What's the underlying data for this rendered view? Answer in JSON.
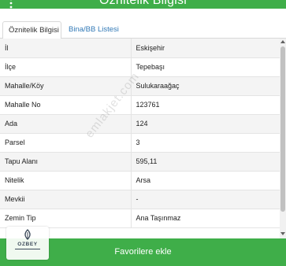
{
  "header": {
    "title": "Öznitelik Bilgisi",
    "menu_icon": "kebab-menu-icon"
  },
  "tabs": [
    {
      "label": "Öznitelik Bilgisi",
      "active": true
    },
    {
      "label": "Bina/BB Listesi",
      "active": false
    }
  ],
  "attributes": [
    {
      "key": "İl",
      "value": "Eskişehir"
    },
    {
      "key": "İlçe",
      "value": "Tepebaşı"
    },
    {
      "key": "Mahalle/Köy",
      "value": "Sulukaraağaç"
    },
    {
      "key": "Mahalle No",
      "value": "123761"
    },
    {
      "key": "Ada",
      "value": "124"
    },
    {
      "key": "Parsel",
      "value": "3"
    },
    {
      "key": "Tapu Alanı",
      "value": "595,11"
    },
    {
      "key": "Nitelik",
      "value": "Arsa"
    },
    {
      "key": "Mevkii",
      "value": "-"
    },
    {
      "key": "Zemin Tip",
      "value": "Ana Taşınmaz"
    }
  ],
  "footer": {
    "button_label": "Favorilere ekle"
  },
  "logo": {
    "text": "OZBEY"
  },
  "watermark": {
    "text": "emlakjet.com"
  },
  "colors": {
    "accent": "#3fae49",
    "link": "#337ab7"
  }
}
